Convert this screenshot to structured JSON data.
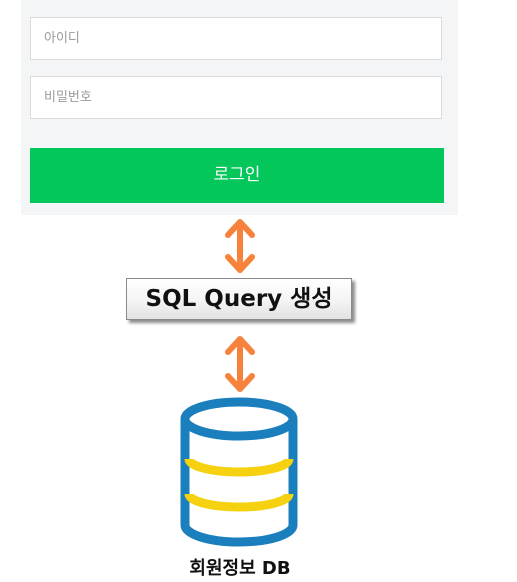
{
  "login_form": {
    "id_placeholder": "아이디",
    "password_placeholder": "비밀번호",
    "login_button_label": "로그인"
  },
  "flow": {
    "sql_step_label": "SQL Query 생성",
    "db_label": "회원정보 DB"
  },
  "colors": {
    "panel_bg": "#f4f5f7",
    "login_button": "#03c75a",
    "arrow": "#f6823c",
    "db_blue": "#1b7fbd",
    "db_stripe": "#f5d110"
  },
  "icons": {
    "arrow": "double-headed-vertical-arrow",
    "database": "database-cylinder"
  }
}
